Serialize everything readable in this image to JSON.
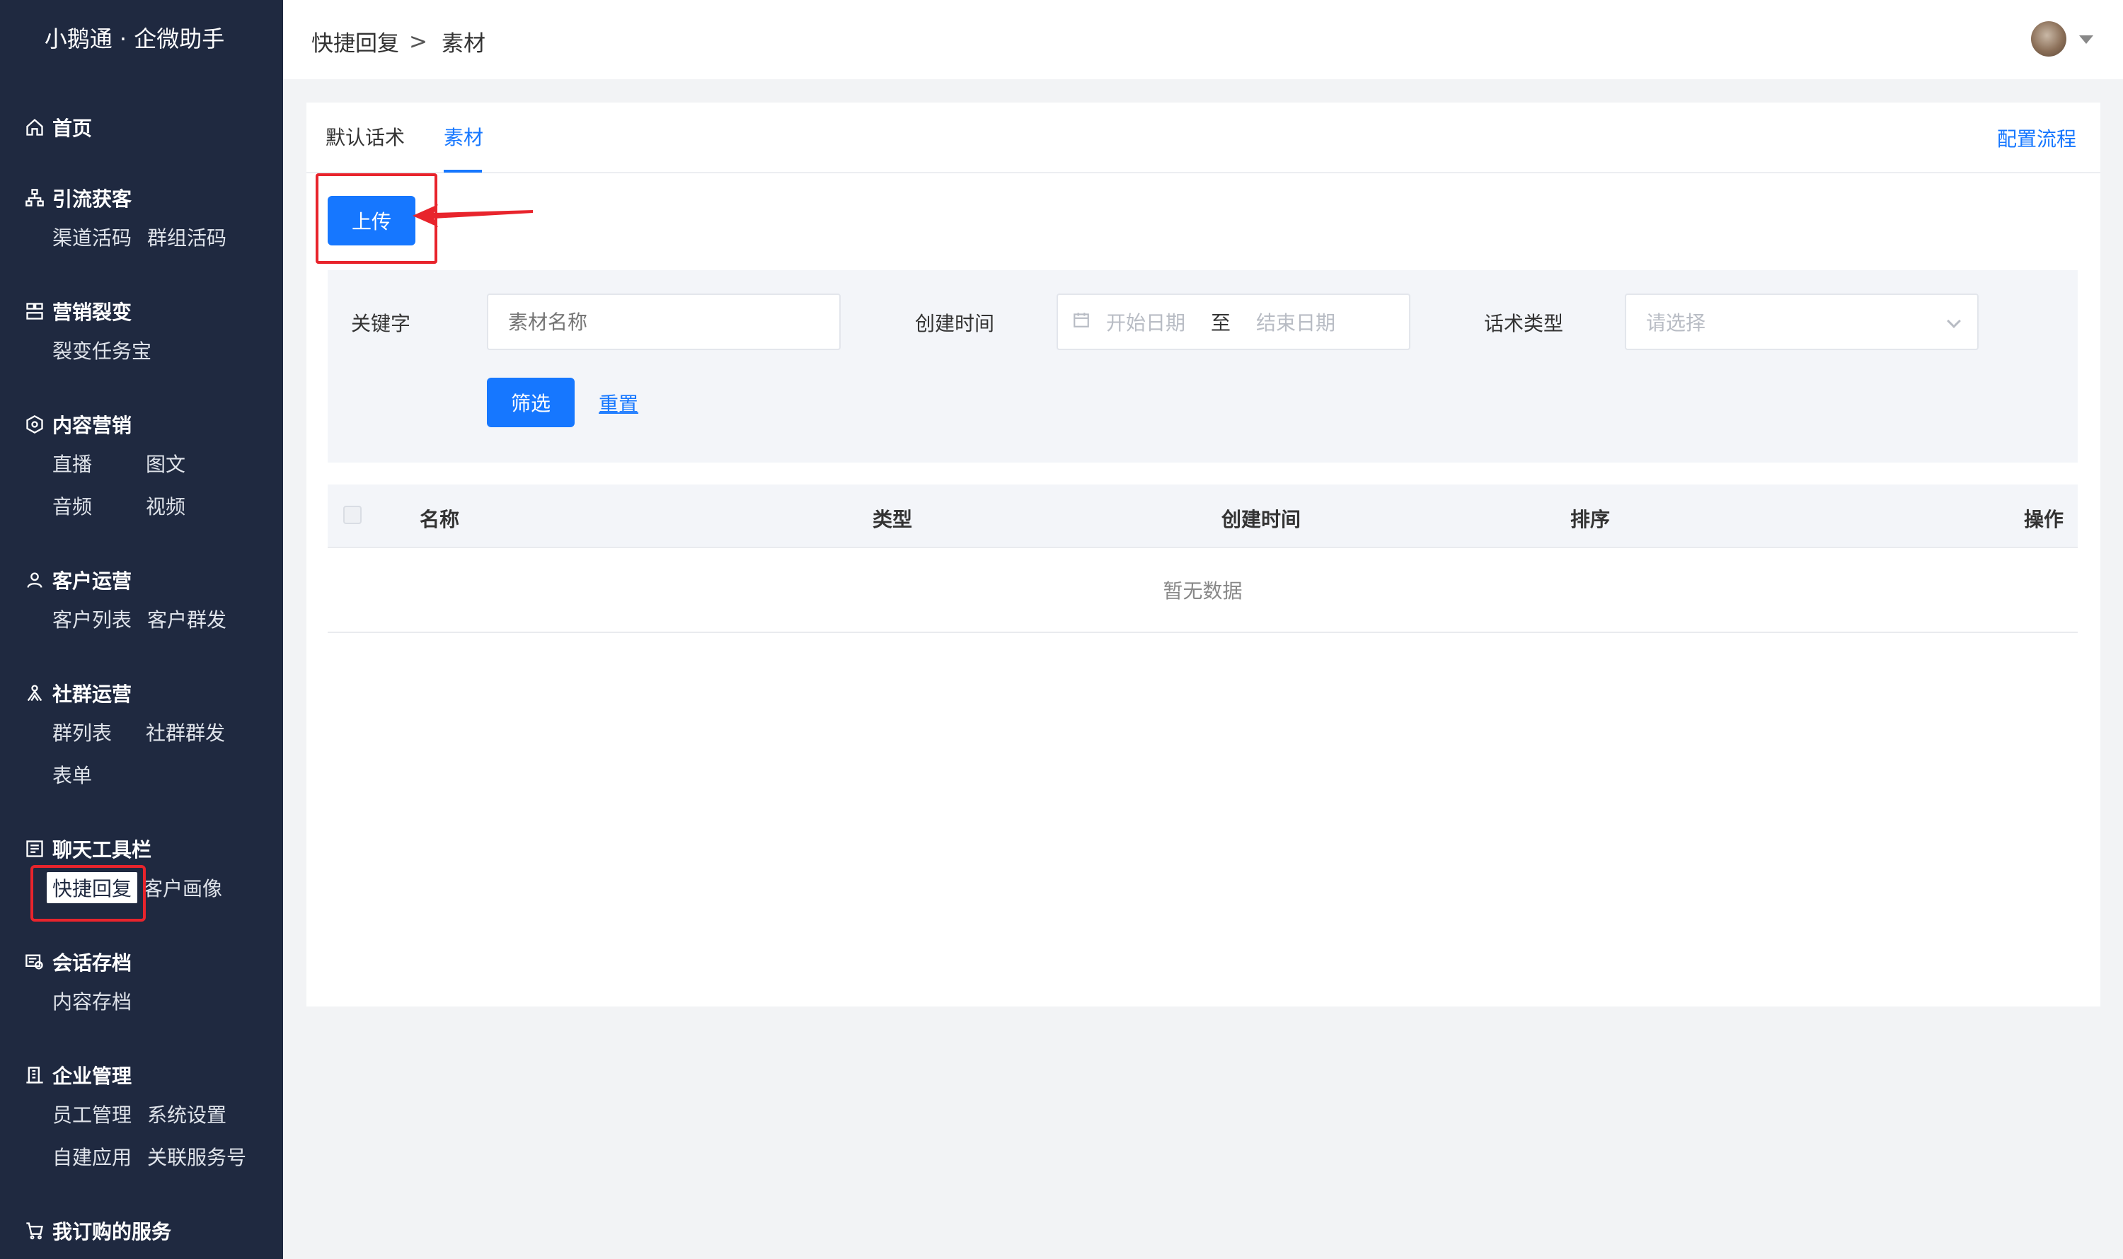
{
  "app": {
    "title": "小鹅通 · 企微助手"
  },
  "sidebar": {
    "groups": [
      {
        "label": "首页",
        "icon": "home-icon",
        "items": []
      },
      {
        "label": "引流获客",
        "icon": "org-tree-icon",
        "items": [
          "渠道活码",
          "群组活码"
        ]
      },
      {
        "label": "营销裂变",
        "icon": "split-icon",
        "items": [
          "裂变任务宝"
        ]
      },
      {
        "label": "内容营销",
        "icon": "content-icon",
        "items": [
          "直播",
          "图文",
          "音频",
          "视频"
        ]
      },
      {
        "label": "客户运营",
        "icon": "user-icon",
        "items": [
          "客户列表",
          "客户群发"
        ]
      },
      {
        "label": "社群运营",
        "icon": "community-icon",
        "items": [
          "群列表",
          "社群群发",
          "表单"
        ]
      },
      {
        "label": "聊天工具栏",
        "icon": "toolbar-icon",
        "items": [
          "快捷回复",
          "客户画像"
        ]
      },
      {
        "label": "会话存档",
        "icon": "archive-icon",
        "items": [
          "内容存档"
        ]
      },
      {
        "label": "企业管理",
        "icon": "building-icon",
        "items": [
          "员工管理",
          "系统设置",
          "自建应用",
          "关联服务号"
        ]
      },
      {
        "label": "我订购的服务",
        "icon": "cart-icon",
        "items": []
      }
    ],
    "active_item": "快捷回复"
  },
  "header": {
    "breadcrumb": [
      "快捷回复",
      "素材"
    ],
    "breadcrumb_sep": ">"
  },
  "tabs": [
    {
      "label": "默认话术",
      "active": false
    },
    {
      "label": "素材",
      "active": true
    }
  ],
  "config_link": "配置流程",
  "upload_label": "上传",
  "filter": {
    "keyword_label": "关键字",
    "keyword_placeholder": "素材名称",
    "created_label": "创建时间",
    "start_placeholder": "开始日期",
    "range_sep": "至",
    "end_placeholder": "结束日期",
    "type_label": "话术类型",
    "type_placeholder": "请选择",
    "filter_button": "筛选",
    "reset_link": "重置"
  },
  "table": {
    "columns": [
      "名称",
      "类型",
      "创建时间",
      "排序",
      "操作"
    ],
    "empty_text": "暂无数据"
  },
  "colors": {
    "sidebar_bg": "#1f2940",
    "accent": "#1677ff",
    "highlight": "#e8242c"
  }
}
